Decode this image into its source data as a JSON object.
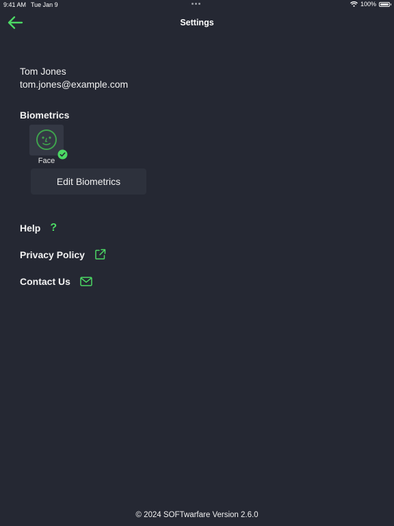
{
  "status_bar": {
    "time": "9:41 AM",
    "date": "Tue Jan 9",
    "battery": "100%"
  },
  "nav": {
    "title": "Settings",
    "back_icon": "arrow-left-icon"
  },
  "user": {
    "name": "Tom Jones",
    "email": "tom.jones@example.com"
  },
  "biometrics": {
    "title": "Biometrics",
    "face_label": "Face",
    "enrolled_icon": "check-circle-icon",
    "edit_label": "Edit Biometrics"
  },
  "links": {
    "help": "Help",
    "help_icon": "?",
    "privacy": "Privacy Policy",
    "contact": "Contact Us"
  },
  "footer": {
    "text": "© 2024 SOFTwarfare Version 2.6.0"
  },
  "colors": {
    "background": "#252833",
    "accent": "#4cd964",
    "tile": "#343844",
    "button": "#2d313c"
  }
}
